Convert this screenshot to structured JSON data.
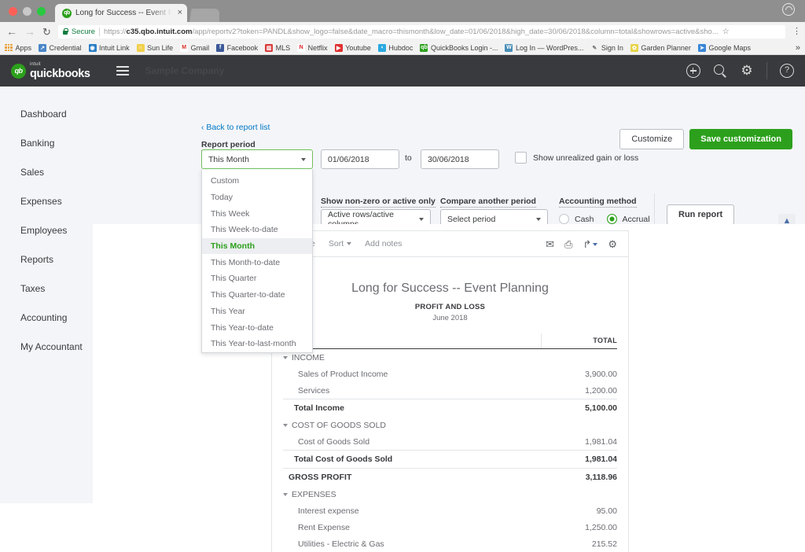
{
  "browser": {
    "tab_title": "Long for Success -- Event Pla",
    "tab_favicon": "qb",
    "tab_close": "×",
    "back_icon": "←",
    "forward_icon": "→",
    "reload_icon": "↻",
    "secure_label": "Secure",
    "url_scheme": "https://",
    "url_host": "c35.qbo.intuit.com",
    "url_path": "/app/reportv2?token=PANDL&show_logo=false&date_macro=thismonth&low_date=01/06/2018&high_date=30/06/2018&column=total&showrows=active&sho...",
    "star_icon": "☆",
    "menu_icon": "⋮",
    "bookmarks_overflow": "»",
    "bookmarks": [
      {
        "label": "Apps",
        "icon": "apps-grid-icon",
        "glyph": "",
        "color": "#f2f2f2"
      },
      {
        "label": "Credential",
        "icon": "credential-icon",
        "glyph": "↗",
        "color": "#4a86c8"
      },
      {
        "label": "Intuit Link",
        "icon": "intuit-link-icon",
        "glyph": "◉",
        "color": "#2b7fc4"
      },
      {
        "label": "Sun Life",
        "icon": "sun-life-icon",
        "glyph": "☼",
        "color": "#f2d04b"
      },
      {
        "label": "Gmail",
        "icon": "gmail-icon",
        "glyph": "M",
        "color": "#ffffff"
      },
      {
        "label": "Facebook",
        "icon": "facebook-icon",
        "glyph": "f",
        "color": "#3b5998"
      },
      {
        "label": "MLS",
        "icon": "mls-icon",
        "glyph": "▥",
        "color": "#d93b3b"
      },
      {
        "label": "Netflix",
        "icon": "netflix-icon",
        "glyph": "N",
        "color": "#ffffff"
      },
      {
        "label": "Youtube",
        "icon": "youtube-icon",
        "glyph": "▶",
        "color": "#e02f2f"
      },
      {
        "label": "Hubdoc",
        "icon": "hubdoc-icon",
        "glyph": "◖",
        "color": "#2aa9e0"
      },
      {
        "label": "QuickBooks Login -...",
        "icon": "quickbooks-icon",
        "glyph": "qb",
        "color": "#2ca01c"
      },
      {
        "label": "Log In — WordPres...",
        "icon": "wordpress-icon",
        "glyph": "W",
        "color": "#4a8fb8"
      },
      {
        "label": "Sign In",
        "icon": "sign-in-icon",
        "glyph": "✎",
        "color": "#f2f2f2"
      },
      {
        "label": "Garden Planner",
        "icon": "garden-planner-icon",
        "glyph": "✿",
        "color": "#e8d44a"
      },
      {
        "label": "Google Maps",
        "icon": "google-maps-icon",
        "glyph": "➤",
        "color": "#3a86d8"
      }
    ]
  },
  "qb_header": {
    "brand_intuit": "intuit",
    "brand_name": "quickbooks",
    "brand_badge": "qb",
    "company": "Sample Company",
    "icons": [
      {
        "name": "plus-icon",
        "glyph": "+"
      },
      {
        "name": "search-icon",
        "glyph": ""
      },
      {
        "name": "gear-icon",
        "glyph": "⚙"
      },
      {
        "name": "help-icon",
        "glyph": "?"
      }
    ]
  },
  "sidebar": {
    "items": [
      {
        "label": "Dashboard"
      },
      {
        "label": "Banking"
      },
      {
        "label": "Sales"
      },
      {
        "label": "Expenses"
      },
      {
        "label": "Employees"
      },
      {
        "label": "Reports"
      },
      {
        "label": "Taxes"
      },
      {
        "label": "Accounting"
      },
      {
        "label": "My Accountant"
      }
    ]
  },
  "toolbar": {
    "back_to_list": "Back to report list",
    "back_chevron": "‹",
    "customize_label": "Customize",
    "save_customization_label": "Save customization",
    "run_report_label": "Run report",
    "collapse_panel_icon": "▲"
  },
  "filters": {
    "report_period_label": "Report period",
    "report_period_value": "This Month",
    "period_options": [
      "Custom",
      "Today",
      "This Week",
      "This Week-to-date",
      "This Month",
      "This Month-to-date",
      "This Quarter",
      "This Quarter-to-date",
      "This Year",
      "This Year-to-date",
      "This Year-to-last-month"
    ],
    "selected_option": "This Month",
    "date_from": "01/06/2018",
    "to_label": "to",
    "date_to": "30/06/2018",
    "unrealized_label": "Show unrealized gain or loss",
    "unrealized_checked": false,
    "nonzero_label": "Show non-zero or active only",
    "nonzero_value": "Active rows/active columns",
    "compare_label": "Compare another period",
    "compare_value": "Select period",
    "accounting_method_label": "Accounting method",
    "method_cash": "Cash",
    "method_accrual": "Accrual",
    "method_selected": "Accrual"
  },
  "report": {
    "toolbar": {
      "collapse": "Collapse",
      "sort": "Sort",
      "add_notes": "Add notes",
      "icons": [
        {
          "name": "email-icon",
          "glyph": "✉"
        },
        {
          "name": "print-icon",
          "glyph": "⎙"
        },
        {
          "name": "export-icon",
          "glyph": "↱"
        },
        {
          "name": "settings-gear-icon",
          "glyph": "⚙"
        }
      ]
    },
    "company_title": "Long for Success -- Event Planning",
    "report_name": "PROFIT AND LOSS",
    "period": "June 2018",
    "column_header": "TOTAL",
    "rows": [
      {
        "type": "section",
        "label": "INCOME",
        "amount": ""
      },
      {
        "type": "item",
        "label": "Sales of Product Income",
        "amount": "3,900.00"
      },
      {
        "type": "item",
        "label": "Services",
        "amount": "1,200.00"
      },
      {
        "type": "total",
        "label": "Total Income",
        "amount": "5,100.00"
      },
      {
        "type": "section",
        "label": "COST OF GOODS SOLD",
        "amount": ""
      },
      {
        "type": "item",
        "label": "Cost of Goods Sold",
        "amount": "1,981.04"
      },
      {
        "type": "total",
        "label": "Total Cost of Goods Sold",
        "amount": "1,981.04"
      },
      {
        "type": "grand",
        "label": "GROSS PROFIT",
        "amount": "3,118.96"
      },
      {
        "type": "section",
        "label": "EXPENSES",
        "amount": ""
      },
      {
        "type": "item",
        "label": "Interest expense",
        "amount": "95.00"
      },
      {
        "type": "item",
        "label": "Rent Expense",
        "amount": "1,250.00"
      },
      {
        "type": "item",
        "label": "Utilities - Electric & Gas",
        "amount": "215.52"
      }
    ]
  }
}
